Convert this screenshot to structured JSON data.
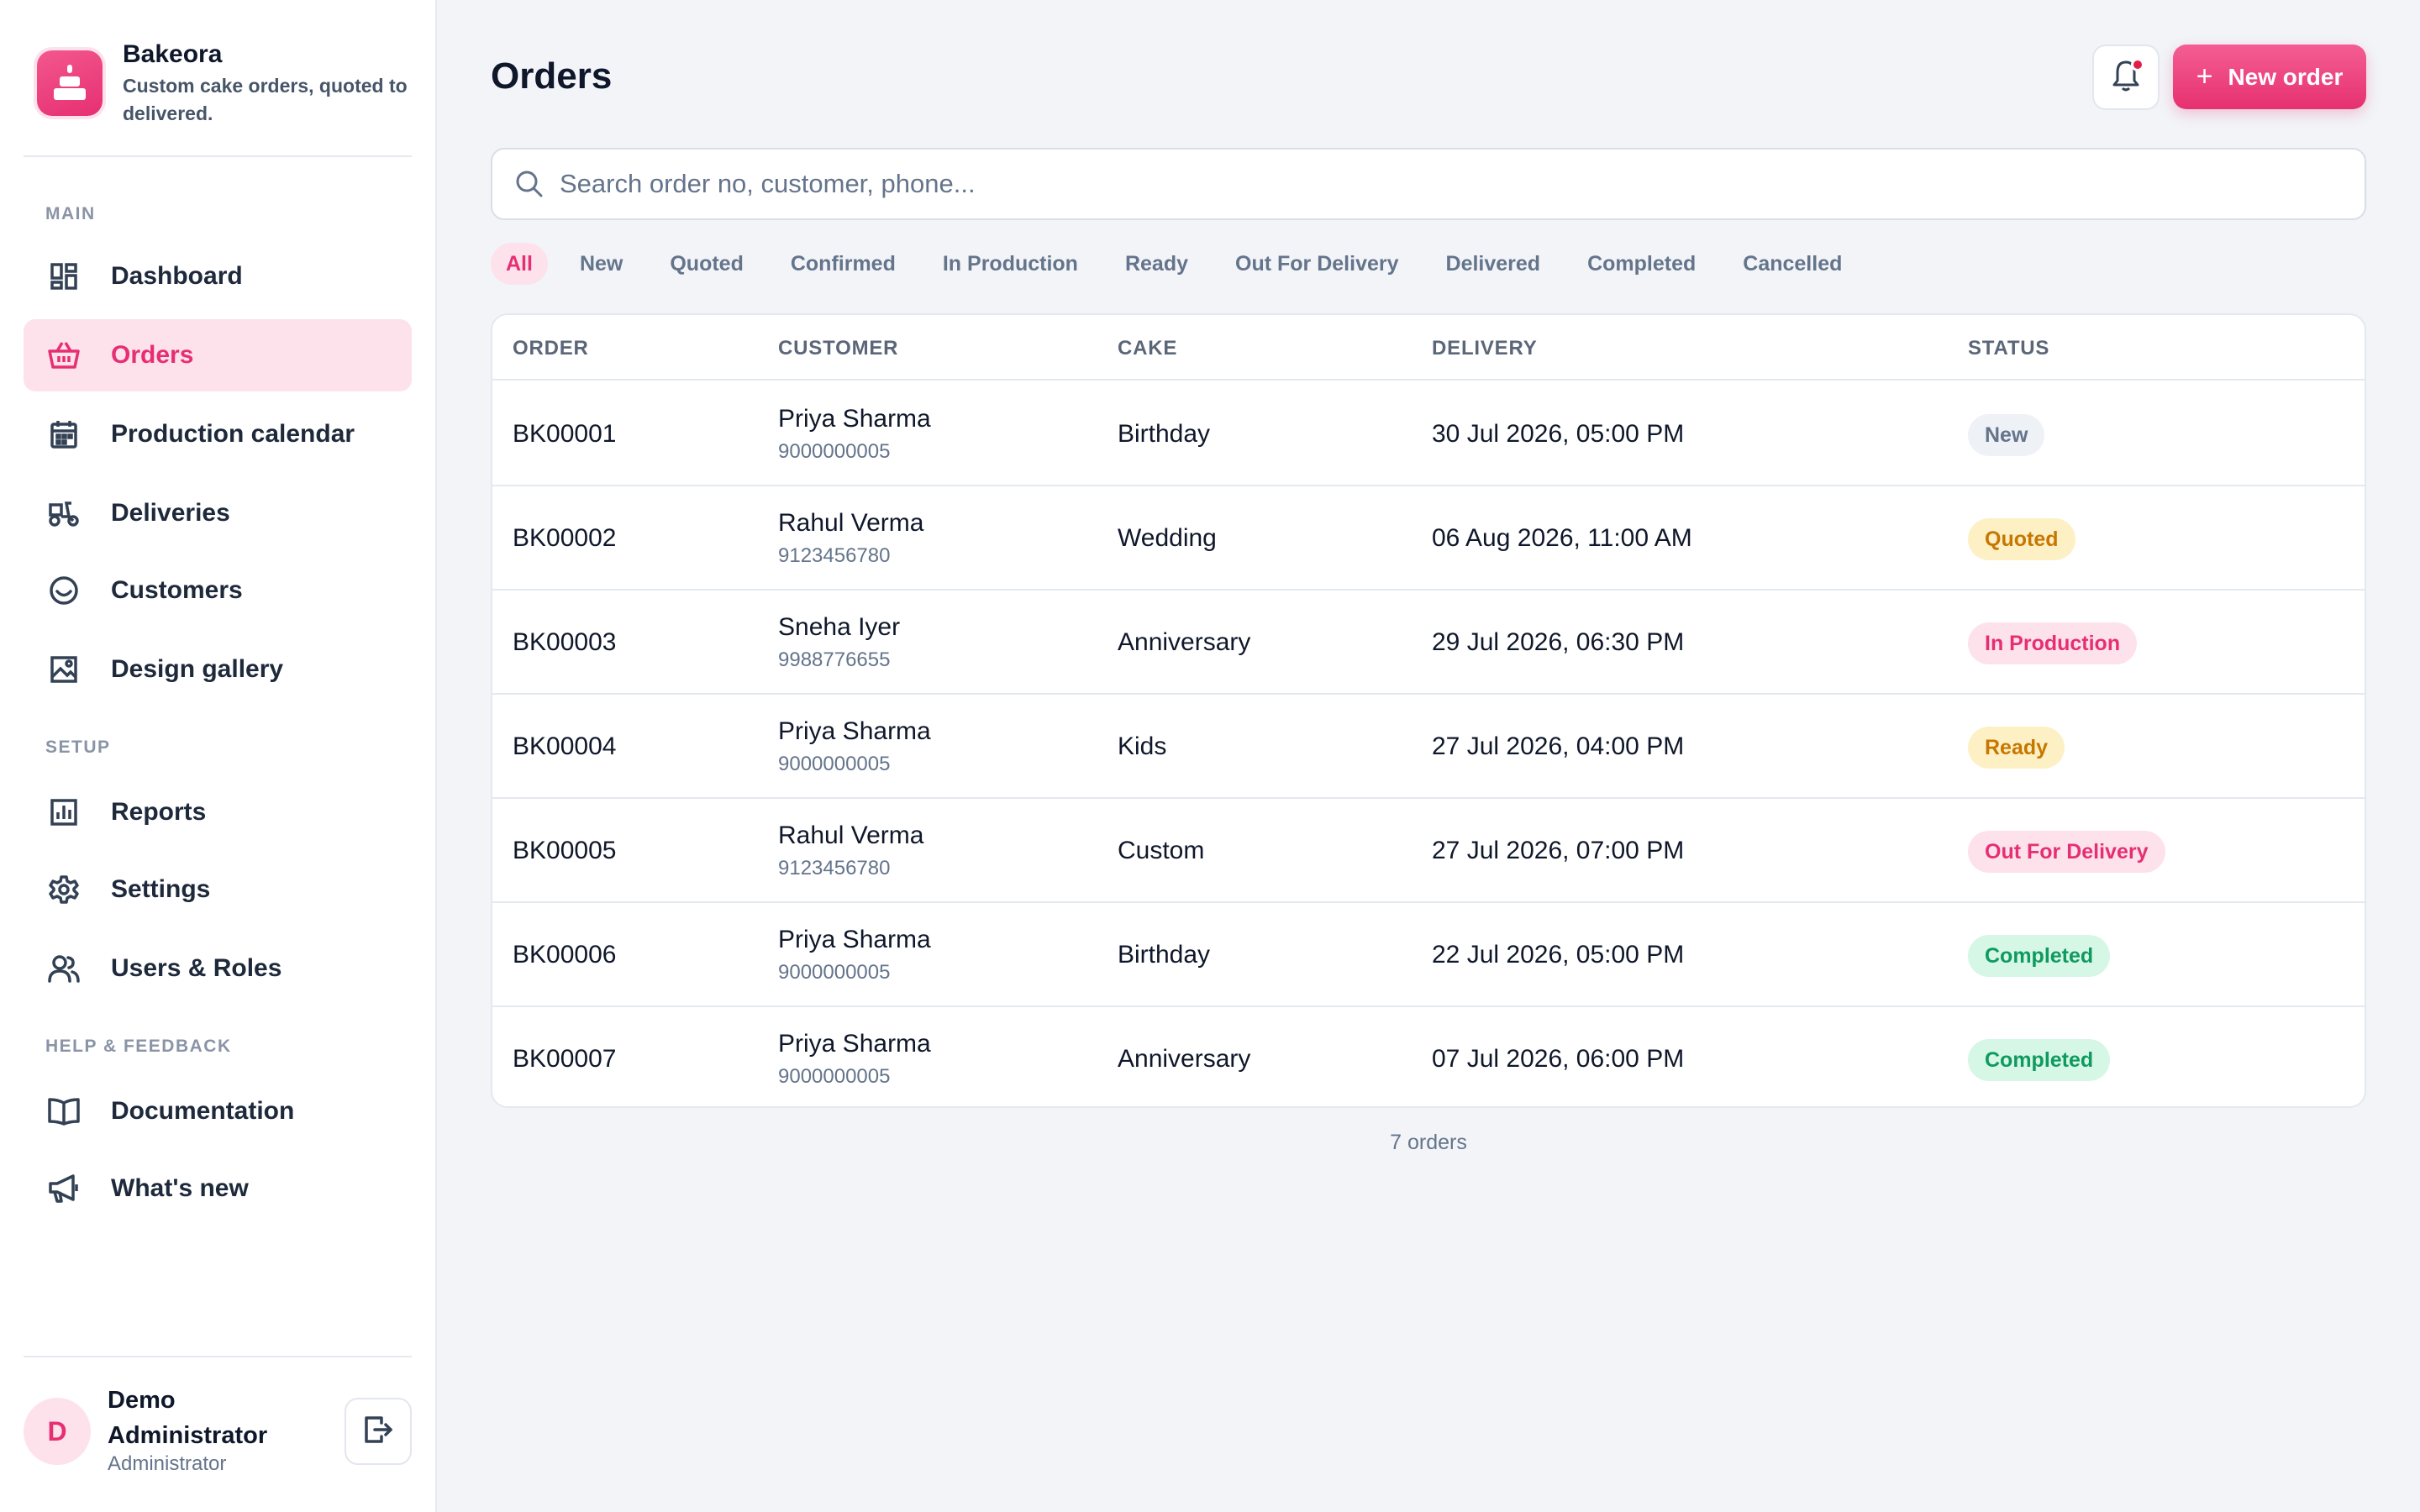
{
  "brand": {
    "name": "Bakeora",
    "tagline": "Custom cake orders, quoted to delivered.",
    "accent": "#e62f72"
  },
  "sidebar": {
    "sections": [
      {
        "label": "MAIN",
        "items": [
          {
            "label": "Dashboard",
            "icon": "dashboard-icon",
            "active": false
          },
          {
            "label": "Orders",
            "icon": "basket-icon",
            "active": true
          },
          {
            "label": "Production calendar",
            "icon": "calendar-icon",
            "active": false
          },
          {
            "label": "Deliveries",
            "icon": "scooter-icon",
            "active": false
          },
          {
            "label": "Customers",
            "icon": "smile-icon",
            "active": false
          },
          {
            "label": "Design gallery",
            "icon": "image-icon",
            "active": false
          }
        ]
      },
      {
        "label": "SETUP",
        "items": [
          {
            "label": "Reports",
            "icon": "bar-chart-icon",
            "active": false
          },
          {
            "label": "Settings",
            "icon": "gear-icon",
            "active": false
          },
          {
            "label": "Users & Roles",
            "icon": "users-icon",
            "active": false
          }
        ]
      },
      {
        "label": "HELP & FEEDBACK",
        "items": [
          {
            "label": "Documentation",
            "icon": "book-icon",
            "active": false
          },
          {
            "label": "What's new",
            "icon": "megaphone-icon",
            "active": false
          }
        ]
      }
    ]
  },
  "user": {
    "initial": "D",
    "name": "Demo Administrator",
    "role": "Administrator"
  },
  "header": {
    "title": "Orders",
    "new_button": "New order",
    "bell_has_dot": true
  },
  "search": {
    "placeholder": "Search order no, customer, phone...",
    "value": ""
  },
  "filters": [
    {
      "label": "All",
      "active": true
    },
    {
      "label": "New",
      "active": false
    },
    {
      "label": "Quoted",
      "active": false
    },
    {
      "label": "Confirmed",
      "active": false
    },
    {
      "label": "In Production",
      "active": false
    },
    {
      "label": "Ready",
      "active": false
    },
    {
      "label": "Out For Delivery",
      "active": false
    },
    {
      "label": "Delivered",
      "active": false
    },
    {
      "label": "Completed",
      "active": false
    },
    {
      "label": "Cancelled",
      "active": false
    }
  ],
  "table": {
    "columns": {
      "order": "ORDER",
      "customer": "CUSTOMER",
      "cake": "CAKE",
      "delivery": "DELIVERY",
      "status": "STATUS"
    },
    "rows": [
      {
        "order": "BK00001",
        "name": "Priya Sharma",
        "phone": "9000000005",
        "cake": "Birthday",
        "delivery": "30 Jul 2026, 05:00 PM",
        "status": "New",
        "status_class": "st-new"
      },
      {
        "order": "BK00002",
        "name": "Rahul Verma",
        "phone": "9123456780",
        "cake": "Wedding",
        "delivery": "06 Aug 2026, 11:00 AM",
        "status": "Quoted",
        "status_class": "st-quoted"
      },
      {
        "order": "BK00003",
        "name": "Sneha Iyer",
        "phone": "9988776655",
        "cake": "Anniversary",
        "delivery": "29 Jul 2026, 06:30 PM",
        "status": "In Production",
        "status_class": "st-prod"
      },
      {
        "order": "BK00004",
        "name": "Priya Sharma",
        "phone": "9000000005",
        "cake": "Kids",
        "delivery": "27 Jul 2026, 04:00 PM",
        "status": "Ready",
        "status_class": "st-ready"
      },
      {
        "order": "BK00005",
        "name": "Rahul Verma",
        "phone": "9123456780",
        "cake": "Custom",
        "delivery": "27 Jul 2026, 07:00 PM",
        "status": "Out For Delivery",
        "status_class": "st-ofd"
      },
      {
        "order": "BK00006",
        "name": "Priya Sharma",
        "phone": "9000000005",
        "cake": "Birthday",
        "delivery": "22 Jul 2026, 05:00 PM",
        "status": "Completed",
        "status_class": "st-done"
      },
      {
        "order": "BK00007",
        "name": "Priya Sharma",
        "phone": "9000000005",
        "cake": "Anniversary",
        "delivery": "07 Jul 2026, 06:00 PM",
        "status": "Completed",
        "status_class": "st-done"
      }
    ]
  },
  "footer": {
    "count_label": "7 orders"
  }
}
